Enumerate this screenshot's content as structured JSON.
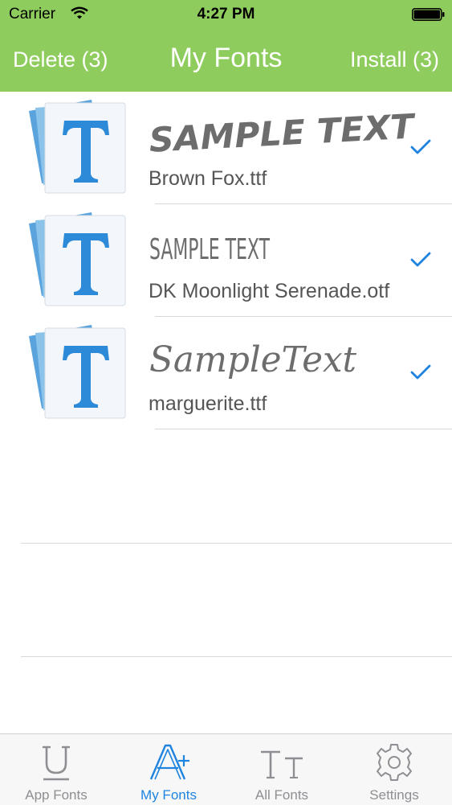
{
  "status_bar": {
    "carrier": "Carrier",
    "time": "4:27 PM",
    "wifi_icon": "wifi-icon",
    "battery_icon": "battery-icon"
  },
  "nav": {
    "delete_label": "Delete (3)",
    "title": "My Fonts",
    "install_label": "Install (3)",
    "bar_color": "#8fcc5e"
  },
  "fonts": [
    {
      "filename": "Brown Fox.ttf",
      "preview_text": "SAMPLE TEXT",
      "selected": true
    },
    {
      "filename": "DK Moonlight Serenade.otf",
      "preview_text": "SAMPLE TEXT",
      "selected": true
    },
    {
      "filename": "marguerite.ttf",
      "preview_text": "SampleText",
      "selected": true
    }
  ],
  "tabs": [
    {
      "label": "App Fonts",
      "icon": "underline-u-icon",
      "active": false
    },
    {
      "label": "My Fonts",
      "icon": "font-add-icon",
      "active": true
    },
    {
      "label": "All Fonts",
      "icon": "text-size-icon",
      "active": false
    },
    {
      "label": "Settings",
      "icon": "gear-icon",
      "active": false
    }
  ],
  "colors": {
    "accent": "#1f84e0",
    "inactive_tab": "#8e8e93",
    "separator": "#d9d9d9"
  }
}
